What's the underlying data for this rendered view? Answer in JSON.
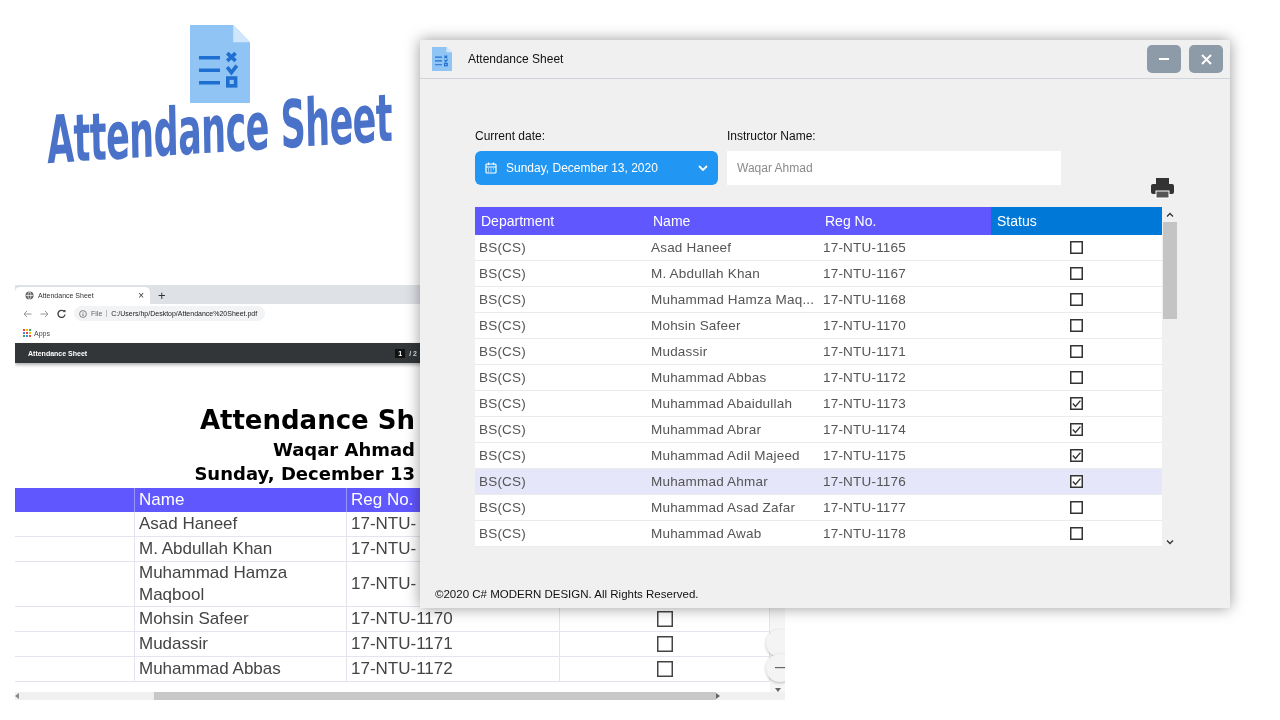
{
  "logo": {
    "title": "Attendance Sheet"
  },
  "browser": {
    "tab": {
      "title": "Attendance Sheet",
      "close": "×",
      "new_tab": "+"
    },
    "address": {
      "scheme": "File",
      "url": "C:/Users/hp/Desktop/Attendance%20Sheet.pdf"
    },
    "bookmarks": [
      "Apps"
    ],
    "pdf_toolbar": {
      "title": "Attendance Sheet",
      "page": "1",
      "page_total": "/ 2"
    },
    "document": {
      "title": "Attendance Sh",
      "instructor": "Waqar Ahmad",
      "date": "Sunday, December 13",
      "columns": [
        "Name",
        "Reg No."
      ],
      "rows": [
        {
          "name": "Asad Haneef",
          "reg": "17-NTU-"
        },
        {
          "name": "M. Abdullah Khan",
          "reg": "17-NTU-"
        },
        {
          "name": "Muhammad Hamza Maqbool",
          "reg": "17-NTU-"
        },
        {
          "name": "Mohsin Safeer",
          "reg": "17-NTU-1170",
          "checked": false
        },
        {
          "name": "Mudassir",
          "reg": "17-NTU-1171",
          "checked": false
        },
        {
          "name": "Muhammad Abbas",
          "reg": "17-NTU-1172",
          "checked": false
        }
      ]
    }
  },
  "app": {
    "title": "Attendance Sheet",
    "date_picker": {
      "label": "Current date:",
      "value": "Sunday, December 13, 2020"
    },
    "instructor": {
      "label": "Instructor Name:",
      "placeholder": "Waqar Ahmad"
    },
    "table": {
      "columns": [
        "Department",
        "Name",
        "Reg No.",
        "Status"
      ],
      "rows": [
        {
          "department": "BS(CS)",
          "name": "Asad Haneef",
          "reg": "17-NTU-1165",
          "checked": false,
          "selected": false
        },
        {
          "department": "BS(CS)",
          "name": "M. Abdullah Khan",
          "reg": "17-NTU-1167",
          "checked": false,
          "selected": false
        },
        {
          "department": "BS(CS)",
          "name": "Muhammad Hamza Maq...",
          "reg": "17-NTU-1168",
          "checked": false,
          "selected": false
        },
        {
          "department": "BS(CS)",
          "name": "Mohsin Safeer",
          "reg": "17-NTU-1170",
          "checked": false,
          "selected": false
        },
        {
          "department": "BS(CS)",
          "name": "Mudassir",
          "reg": "17-NTU-1171",
          "checked": false,
          "selected": false
        },
        {
          "department": "BS(CS)",
          "name": "Muhammad Abbas",
          "reg": "17-NTU-1172",
          "checked": false,
          "selected": false
        },
        {
          "department": "BS(CS)",
          "name": "Muhammad Abaidullah",
          "reg": "17-NTU-1173",
          "checked": true,
          "selected": false
        },
        {
          "department": "BS(CS)",
          "name": "Muhammad Abrar",
          "reg": "17-NTU-1174",
          "checked": true,
          "selected": false
        },
        {
          "department": "BS(CS)",
          "name": "Muhammad Adil Majeed",
          "reg": "17-NTU-1175",
          "checked": true,
          "selected": false
        },
        {
          "department": "BS(CS)",
          "name": "Muhammad Ahmar",
          "reg": "17-NTU-1176",
          "checked": true,
          "selected": true
        },
        {
          "department": "BS(CS)",
          "name": "Muhammad Asad Zafar",
          "reg": "17-NTU-1177",
          "checked": false,
          "selected": false
        },
        {
          "department": "BS(CS)",
          "name": "Muhammad Awab",
          "reg": "17-NTU-1178",
          "checked": false,
          "selected": false
        }
      ]
    },
    "footer": "©2020 C# MODERN DESIGN. All Rights Reserved."
  }
}
